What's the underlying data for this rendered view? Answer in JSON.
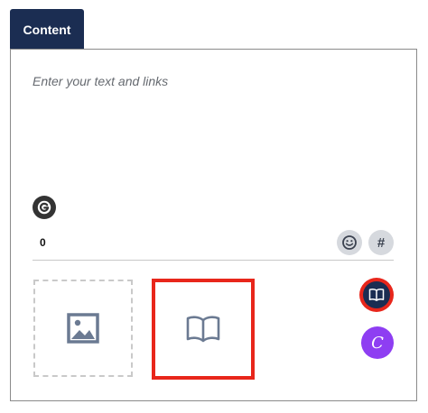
{
  "tabs": {
    "content_label": "Content"
  },
  "editor": {
    "placeholder": "Enter your text and links",
    "char_count": "0"
  },
  "icons": {
    "grammarly": "grammarly-g-icon",
    "emoji": "smiley-icon",
    "hashtag": "hashtag-icon",
    "image": "image-icon",
    "book": "open-book-icon",
    "canva": "canva-c-icon"
  },
  "toolbar": {
    "hashtag_symbol": "#",
    "canva_letter": "C"
  },
  "colors": {
    "tab_background": "#1b2d52",
    "highlight_red": "#e8261b",
    "canva_purple": "#8e3ef2",
    "icon_slate": "#6b7a92"
  }
}
